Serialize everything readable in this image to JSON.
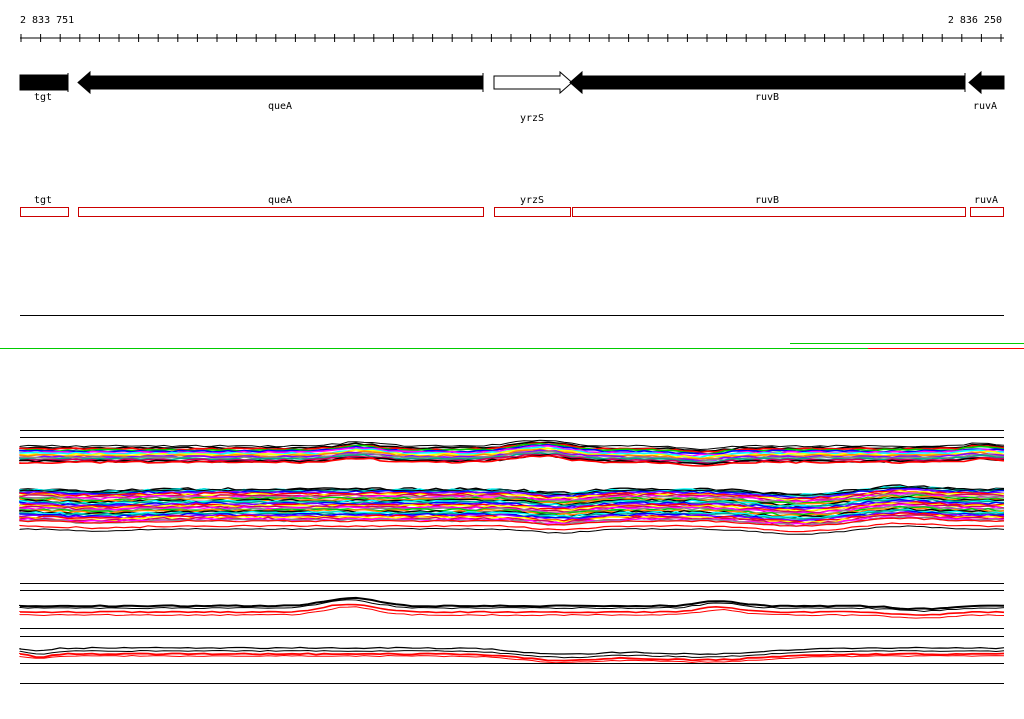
{
  "ruler": {
    "start_label": "2 833 751",
    "end_label": "2 836 250"
  },
  "genes": [
    {
      "name": "tgt",
      "strand": "-"
    },
    {
      "name": "queA",
      "strand": "-"
    },
    {
      "name": "yrzS",
      "strand": "+"
    },
    {
      "name": "ruvB",
      "strand": "-"
    },
    {
      "name": "ruvA",
      "strand": "-"
    }
  ],
  "colors": {
    "gene_minus": "#000000",
    "gene_plus": "#ffffff",
    "cds_outline": "#cc0000",
    "divider_green": "#00cc00",
    "divider_red": "#ff0000",
    "track_palette": [
      "#000000",
      "#ff0000",
      "#00cc00",
      "#0000ff",
      "#ff00ff",
      "#00ffff",
      "#ffff00",
      "#ff8800",
      "#8800ff",
      "#888888",
      "#00aa88",
      "#cc0066"
    ]
  }
}
